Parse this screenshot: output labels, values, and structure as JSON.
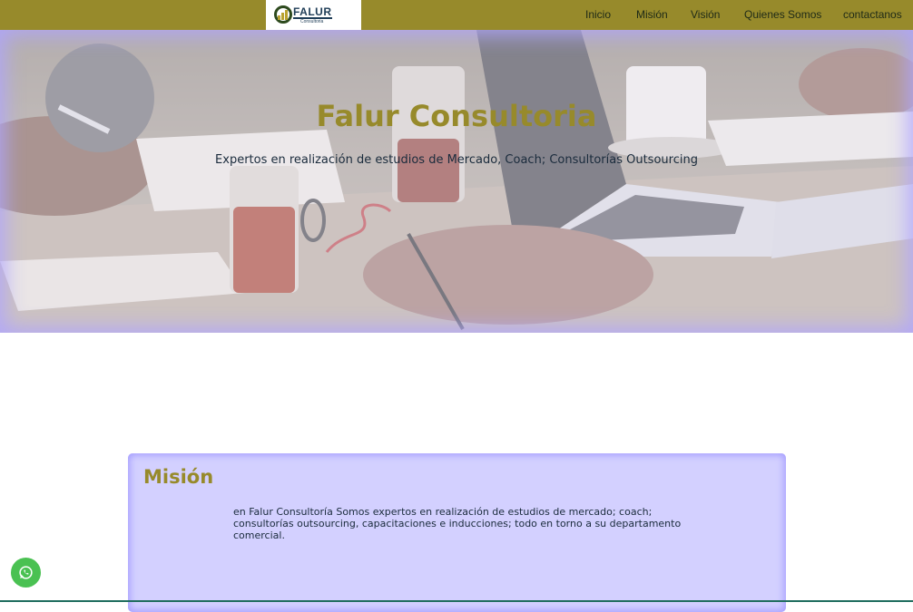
{
  "nav": {
    "logo_text": "FALUR",
    "logo_sub": "Consultoria",
    "links": [
      {
        "label": "Inicio"
      },
      {
        "label": "Misión"
      },
      {
        "label": "Visión"
      },
      {
        "label": "Quienes Somos"
      },
      {
        "label": "contactanos"
      }
    ]
  },
  "hero": {
    "title": "Falur Consultoria",
    "subtitle": "Expertos en realización de estudios de Mercado, Coach; Consultorías Outsourcing"
  },
  "mission": {
    "title": "Misión",
    "text": "en Falur Consultoría Somos expertos en realización de estudios de mercado; coach; consultorías outsourcing, capacitaciones e inducciones; todo en torno a su departamento comercial."
  },
  "whatsapp": {
    "icon": "whatsapp-icon"
  },
  "colors": {
    "accent": "#978a2b",
    "card_bg": "#d3d0ff",
    "whatsapp": "#4ac152",
    "text_dark": "#1a2b3c"
  }
}
